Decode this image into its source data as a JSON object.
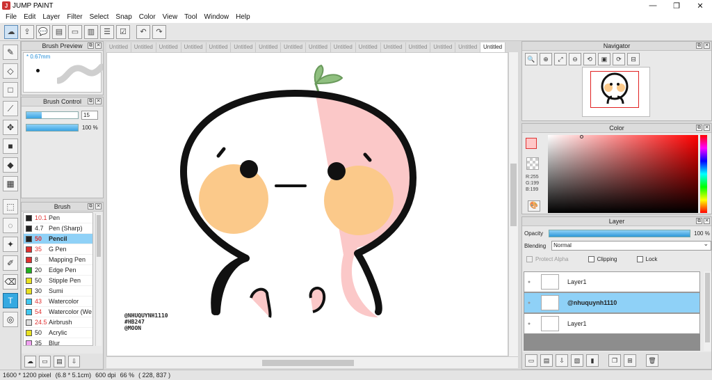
{
  "app": {
    "title": "JUMP PAINT",
    "logo_text": "J"
  },
  "window_buttons": {
    "minimize": "—",
    "maximize": "❐",
    "close": "✕"
  },
  "menu": [
    "File",
    "Edit",
    "Layer",
    "Filter",
    "Select",
    "Snap",
    "Color",
    "View",
    "Tool",
    "Window",
    "Help"
  ],
  "toolbar": {
    "tools": [
      "cloud-sync-icon",
      "share-icon",
      "comment-icon",
      "speech-icon",
      "page-icon",
      "doc-icon",
      "list-icon",
      "grid-check-icon"
    ],
    "tool_glyphs": [
      "☁",
      "⇪",
      "💬",
      "▤",
      "▭",
      "▥",
      "☰",
      "☑"
    ],
    "undo": "↶",
    "redo": "↷"
  },
  "left_tools": {
    "glyphs": [
      "✎",
      "◇",
      "□",
      "⟋",
      "✥",
      "■",
      "◆",
      "▦",
      "⬚",
      "◌",
      "✦",
      "✐",
      "⌫",
      "T",
      "◎"
    ],
    "names": [
      "pen-tool-icon",
      "eraser-tool-icon",
      "shape-tool-icon",
      "line-tool-icon",
      "move-tool-icon",
      "fill-rect-tool-icon",
      "bucket-tool-icon",
      "gradient-tool-icon",
      "select-rect-tool-icon",
      "lasso-tool-icon",
      "magic-wand-tool-icon",
      "select-pen-tool-icon",
      "select-eraser-tool-icon",
      "text-tool-icon",
      "eyedropper-tool-icon"
    ],
    "active_index": 13
  },
  "brush_preview": {
    "title": "Brush Preview",
    "size": "* 0.67mm"
  },
  "brush_control": {
    "title": "Brush Control",
    "size_value": "15",
    "size_fill": 0.3,
    "opacity_value": "100 %",
    "opacity_fill": 1.0
  },
  "brush_panel": {
    "title": "Brush",
    "items": [
      {
        "size": "10.1",
        "name": "Pen",
        "color": "#222222",
        "red": true,
        "selected": false
      },
      {
        "size": "4.7",
        "name": "Pen (Sharp)",
        "color": "#222222",
        "red": false,
        "selected": false
      },
      {
        "size": "50",
        "name": "Pencil",
        "color": "#222222",
        "red": true,
        "selected": true
      },
      {
        "size": "35",
        "name": "G Pen",
        "color": "#e03030",
        "red": true,
        "selected": false
      },
      {
        "size": "8",
        "name": "Mapping Pen",
        "color": "#e03030",
        "red": false,
        "selected": false
      },
      {
        "size": "20",
        "name": "Edge Pen",
        "color": "#20b020",
        "red": false,
        "selected": false
      },
      {
        "size": "50",
        "name": "Stipple Pen",
        "color": "#e8e020",
        "red": false,
        "selected": false
      },
      {
        "size": "30",
        "name": "Sumi",
        "color": "#e8e020",
        "red": false,
        "selected": false
      },
      {
        "size": "43",
        "name": "Watercolor",
        "color": "#40c8f0",
        "red": true,
        "selected": false
      },
      {
        "size": "54",
        "name": "Watercolor (We",
        "color": "#40c8f0",
        "red": true,
        "selected": false
      },
      {
        "size": "24.5",
        "name": "Airbrush",
        "color": "#dddddd",
        "red": true,
        "selected": false
      },
      {
        "size": "50",
        "name": "Acrylic",
        "color": "#e8e020",
        "red": false,
        "selected": false
      },
      {
        "size": "35",
        "name": "Blur",
        "color": "#f0a0f0",
        "red": false,
        "selected": false
      }
    ],
    "footer_glyphs": [
      "☁",
      "▭",
      "▤",
      "⇩"
    ]
  },
  "tabs": {
    "labels": [
      "Untitled",
      "Untitled",
      "Untitled",
      "Untitled",
      "Untitled",
      "Untitled",
      "Untitled",
      "Untitled",
      "Untitled",
      "Untitled",
      "Untitled",
      "Untitled",
      "Untitled",
      "Untitled",
      "Untitled",
      "Untitled"
    ],
    "active_index": 15
  },
  "canvas": {
    "watermark": [
      "@NHUQUYNH1110",
      "#HB247",
      "@MOON"
    ]
  },
  "navigator": {
    "title": "Navigator",
    "buttons": [
      "🔍",
      "⊕",
      "⤢",
      "⊖",
      "⟲",
      "▣",
      "⟳",
      "⊟"
    ]
  },
  "color_panel": {
    "title": "Color",
    "r": "R:255",
    "g": "G:199",
    "b": "B:199",
    "foreground": "#ffc7c7",
    "background": "#111111"
  },
  "layer_panel": {
    "title": "Layer",
    "opacity_label": "Opacity",
    "opacity_value": "100 %",
    "blending_label": "Blending",
    "blending_value": "Normal",
    "protect_alpha": "Protect Alpha",
    "clipping": "Clipping",
    "lock": "Lock",
    "layers": [
      {
        "name": "Layer1",
        "selected": false
      },
      {
        "name": "@nhuquynh1110",
        "selected": true
      },
      {
        "name": "Layer1",
        "selected": false
      }
    ],
    "footer_glyphs": [
      "▭",
      "▤",
      "⇩",
      "▧",
      "▮",
      "❐",
      "⊞",
      "🗑"
    ]
  },
  "status": {
    "pixels": "1600 * 1200 pixel",
    "size": "(6.8 * 5.1cm)",
    "dpi": "600 dpi",
    "zoom": "66 %",
    "coords": "( 228, 837 )"
  }
}
